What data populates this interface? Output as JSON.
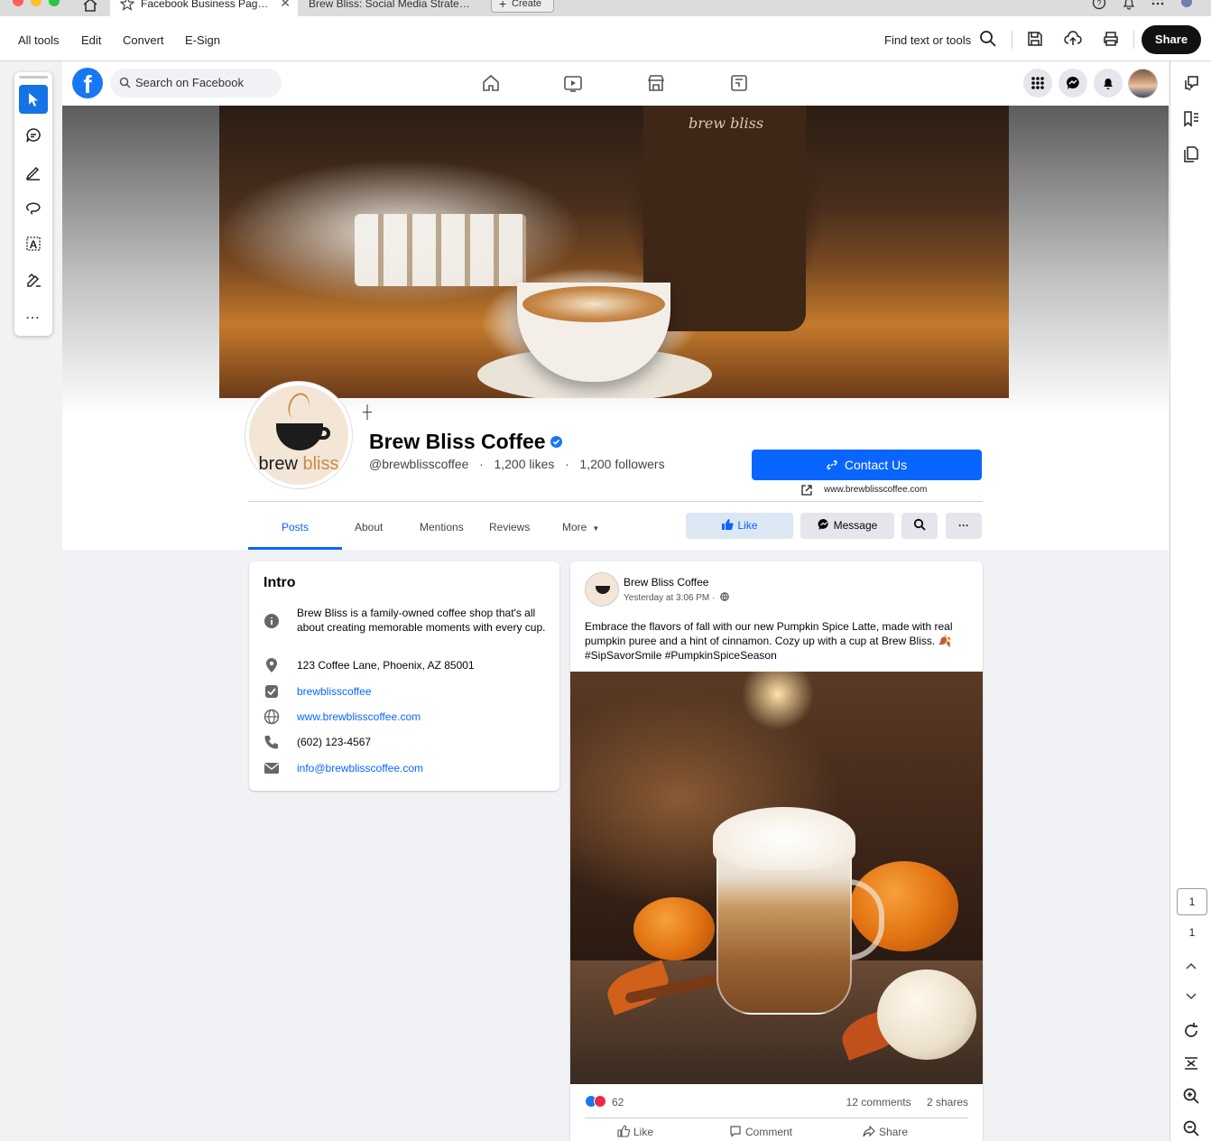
{
  "browser": {
    "active_tab_title": "Facebook Business Pag…",
    "inactive_tab_title": "Brew Bliss: Social Media Strate…",
    "create_label": "Create",
    "close_glyph": "✕"
  },
  "acrobat": {
    "menu": [
      "All tools",
      "Edit",
      "Convert",
      "E-Sign"
    ],
    "find_label": "Find text or tools",
    "share_label": "Share",
    "page_current": "1",
    "page_total": "1",
    "more_glyph": "⋯"
  },
  "facebook": {
    "search_placeholder": "Search on Facebook",
    "logo_letter": "f",
    "page": {
      "name": "Brew Bliss Coffee",
      "handle": "@brewblisscoffee",
      "likes": "1,200 likes",
      "followers": "1,200 followers",
      "separator": "·",
      "logo_text_main": "brew",
      "logo_text_accent": "bliss",
      "cover_brand": "brew bliss"
    },
    "contact_button": "Contact Us",
    "website_short": "www.brewblisscoffee.com",
    "tabs": [
      "Posts",
      "About",
      "Mentions",
      "Reviews",
      "More"
    ],
    "more_caret": "▼",
    "actions": {
      "like": "Like",
      "message": "Message",
      "more": "···"
    },
    "intro": {
      "title": "Intro",
      "description": "Brew Bliss is a family-owned coffee shop that's all about creating memorable moments with every cup.",
      "address": "123 Coffee Lane, Phoenix, AZ 85001",
      "instagram": "brewblisscoffee",
      "website": "www.brewblisscoffee.com",
      "phone": "(602) 123-4567",
      "email": "info@brewblisscoffee.com"
    },
    "post": {
      "author": "Brew Bliss Coffee",
      "time": "Yesterday at 3:06 PM ·",
      "text": "Embrace the flavors of fall with our new Pumpkin Spice Latte, made with real pumpkin puree and a hint of cinnamon. Cozy up with a cup at Brew Bliss. 🍂 #SipSavorSmile #PumpkinSpiceSeason",
      "reaction_count": "62",
      "comments": "12 comments",
      "shares": "2 shares",
      "like_label": "Like",
      "comment_label": "Comment",
      "share_label": "Share"
    }
  },
  "colors": {
    "fb_blue": "#0866ff",
    "acrobat_blue": "#1473e6",
    "fb_bg": "#f0f2f5"
  }
}
